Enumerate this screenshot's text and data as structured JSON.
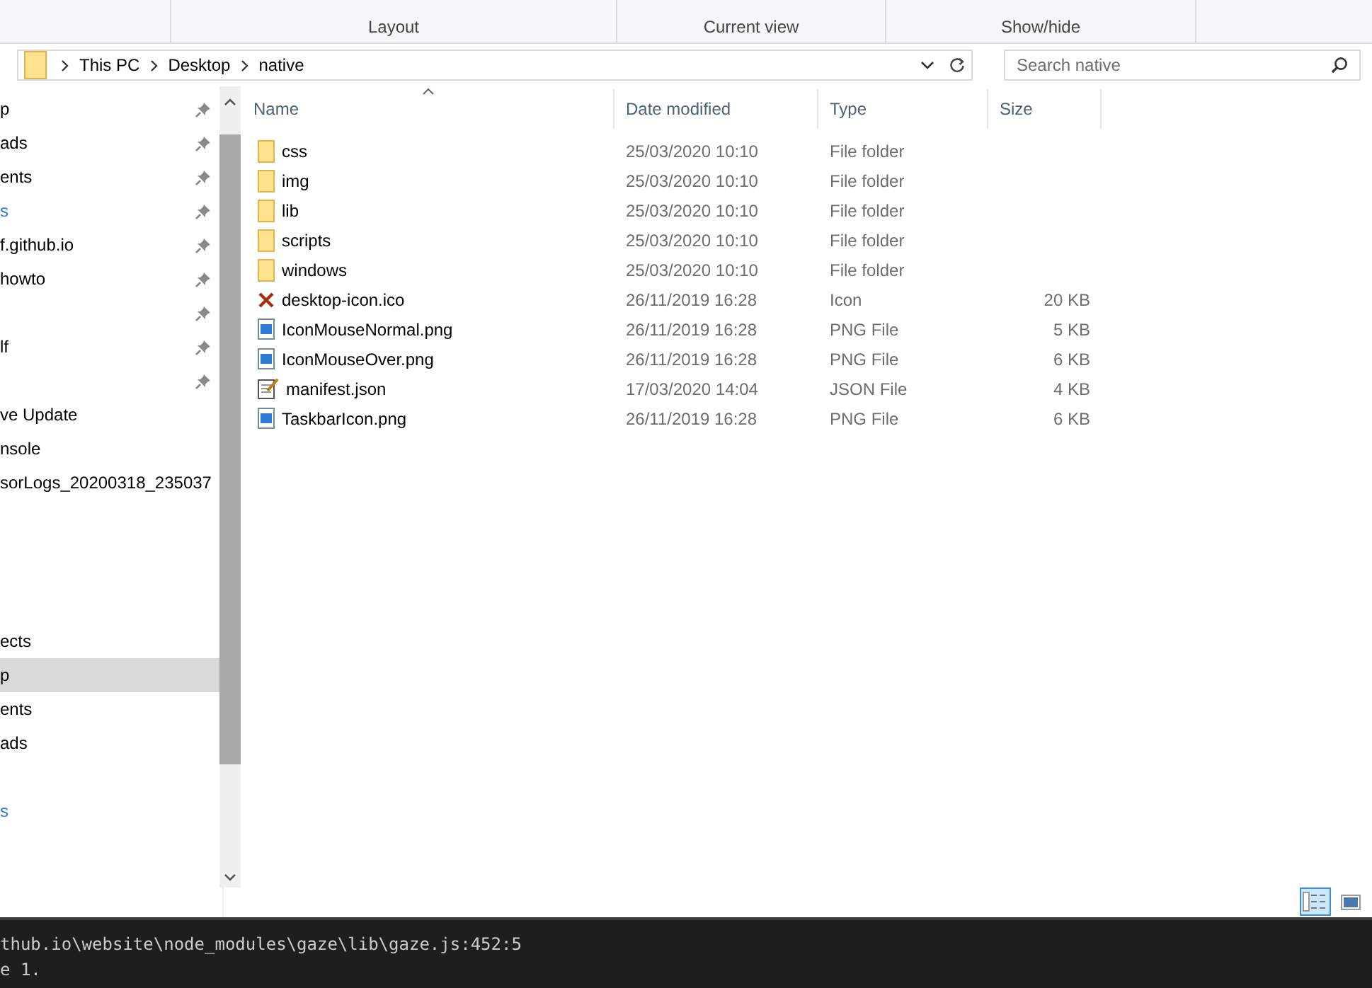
{
  "ribbon": {
    "groups": [
      {
        "label": "Layout"
      },
      {
        "label": "Current view"
      },
      {
        "label": "Show/hide"
      }
    ]
  },
  "address_bar": {
    "path": [
      "This PC",
      "Desktop",
      "native"
    ],
    "search": {
      "placeholder": "Search native"
    }
  },
  "sidebar": {
    "groups": [
      {
        "items": [
          {
            "label": "p",
            "pinned": true,
            "link": false
          },
          {
            "label": "ads",
            "pinned": true,
            "link": false
          },
          {
            "label": "ents",
            "pinned": true,
            "link": false
          },
          {
            "label": "s",
            "pinned": true,
            "link": true
          },
          {
            "label": "f.github.io",
            "pinned": true,
            "link": false
          },
          {
            "label": "howto",
            "pinned": true,
            "link": false
          },
          {
            "pinned": true
          },
          {
            "label": "lf",
            "pinned": true,
            "link": false
          },
          {
            "pinned": true
          },
          {
            "label": "ve Update",
            "pinned": false,
            "link": false
          },
          {
            "label": "nsole",
            "pinned": false,
            "link": false
          },
          {
            "label": "sorLogs_20200318_235037",
            "pinned": false,
            "link": false
          }
        ]
      },
      {
        "items": [
          {
            "label": "ects",
            "selected": false,
            "link": false
          },
          {
            "label": "p",
            "selected": true,
            "link": false
          },
          {
            "label": "ents",
            "selected": false,
            "link": false
          },
          {
            "label": "ads",
            "selected": false,
            "link": false
          },
          {
            "selected": false
          },
          {
            "label": "s",
            "selected": false,
            "link": true
          }
        ]
      }
    ]
  },
  "table": {
    "columns": [
      {
        "label": "Name",
        "sorted": true
      },
      {
        "label": "Date modified",
        "sorted": false
      },
      {
        "label": "Type",
        "sorted": false
      },
      {
        "label": "Size",
        "sorted": false
      }
    ],
    "rows": [
      {
        "kind": "folder",
        "name": "css",
        "date": "25/03/2020 10:10",
        "type": "File folder"
      },
      {
        "kind": "folder",
        "name": "img",
        "date": "25/03/2020 10:10",
        "type": "File folder"
      },
      {
        "kind": "folder",
        "name": "lib",
        "date": "25/03/2020 10:10",
        "type": "File folder"
      },
      {
        "kind": "folder",
        "name": "scripts",
        "date": "25/03/2020 10:10",
        "type": "File folder"
      },
      {
        "kind": "folder",
        "name": "windows",
        "date": "25/03/2020 10:10",
        "type": "File folder"
      },
      {
        "kind": "ico",
        "name": "desktop-icon.ico",
        "date": "26/11/2019 16:28",
        "type": "Icon",
        "size": "20 KB"
      },
      {
        "kind": "png",
        "name": "IconMouseNormal.png",
        "date": "26/11/2019 16:28",
        "type": "PNG File",
        "size": "5 KB"
      },
      {
        "kind": "png",
        "name": "IconMouseOver.png",
        "date": "26/11/2019 16:28",
        "type": "PNG File",
        "size": "6 KB"
      },
      {
        "kind": "json",
        "name": "manifest.json",
        "date": "17/03/2020 14:04",
        "type": "JSON File",
        "size": "4 KB"
      },
      {
        "kind": "png",
        "name": "TaskbarIcon.png",
        "date": "26/11/2019 16:28",
        "type": "PNG File",
        "size": "6 KB"
      }
    ]
  },
  "view_buttons": [
    {
      "kind": "details",
      "selected": true
    },
    {
      "kind": "large",
      "selected": false
    }
  ],
  "terminal": {
    "lines": [
      "thub.io\\website\\node_modules\\gaze\\lib\\gaze.js:452:5",
      "e 1."
    ]
  }
}
